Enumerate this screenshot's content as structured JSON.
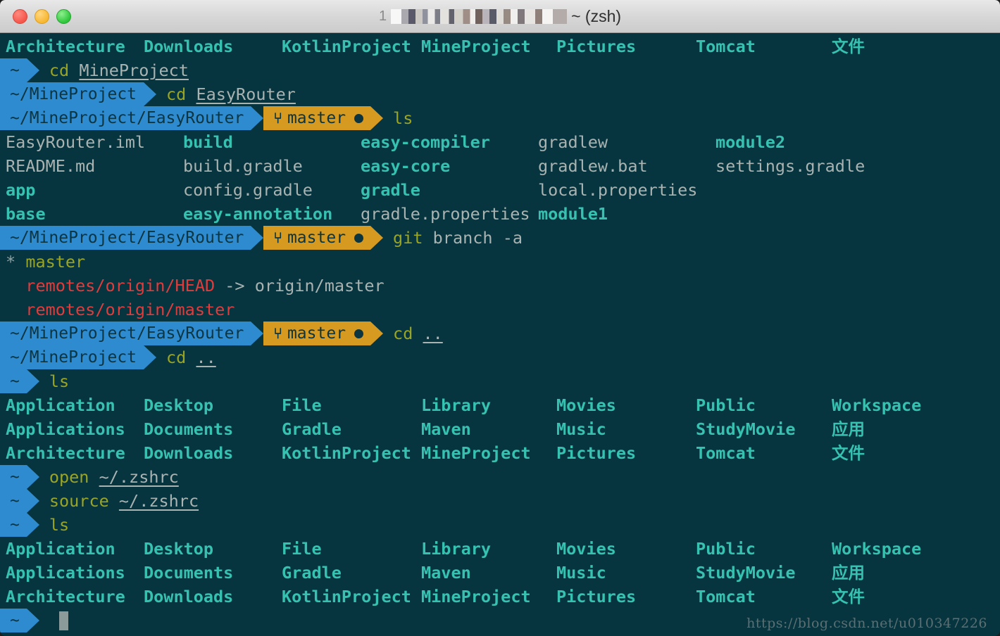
{
  "window": {
    "title_prefix": "1",
    "title_suffix": "~ (zsh)",
    "traffic_lights": [
      "close-button",
      "minimize-button",
      "zoom-button"
    ]
  },
  "terminal": {
    "watermark": "https://blog.csdn.net/u010347226",
    "scrollback_top_row": {
      "cells": [
        "Architecture",
        "Downloads",
        "KotlinProject",
        "MineProject",
        "Pictures",
        "Tomcat",
        "文件"
      ]
    },
    "prompts": {
      "home": "~",
      "mineproject": "~/MineProject",
      "easyrouter": "~/MineProject/EasyRouter",
      "branch": "master",
      "branch_glyph": "⑂"
    },
    "commands": {
      "cd_mineproject": {
        "cmd": "cd",
        "arg": "MineProject"
      },
      "cd_easyrouter": {
        "cmd": "cd",
        "arg": "EasyRouter"
      },
      "ls_1": {
        "cmd": "ls",
        "arg": ""
      },
      "git_branch_a": {
        "cmd": "git",
        "arg": "branch -a"
      },
      "cd_up_1": {
        "cmd": "cd",
        "arg": ".."
      },
      "cd_up_2": {
        "cmd": "cd",
        "arg": ".."
      },
      "ls_2": {
        "cmd": "ls",
        "arg": ""
      },
      "open_zshrc": {
        "cmd": "open",
        "arg": "~/.zshrc"
      },
      "source_zshrc": {
        "cmd": "source",
        "arg": "~/.zshrc"
      },
      "ls_3": {
        "cmd": "ls",
        "arg": ""
      }
    },
    "project_listing": {
      "rows": [
        [
          {
            "text": "EasyRouter.iml",
            "kind": "file"
          },
          {
            "text": "build",
            "kind": "dir"
          },
          {
            "text": "easy-compiler",
            "kind": "dir"
          },
          {
            "text": "gradlew",
            "kind": "file"
          },
          {
            "text": "module2",
            "kind": "dir"
          }
        ],
        [
          {
            "text": "README.md",
            "kind": "file"
          },
          {
            "text": "build.gradle",
            "kind": "file"
          },
          {
            "text": "easy-core",
            "kind": "dir"
          },
          {
            "text": "gradlew.bat",
            "kind": "file"
          },
          {
            "text": "settings.gradle",
            "kind": "file"
          }
        ],
        [
          {
            "text": "app",
            "kind": "dir"
          },
          {
            "text": "config.gradle",
            "kind": "file"
          },
          {
            "text": "gradle",
            "kind": "dir"
          },
          {
            "text": "local.properties",
            "kind": "file"
          },
          {
            "text": "",
            "kind": "file"
          }
        ],
        [
          {
            "text": "base",
            "kind": "dir"
          },
          {
            "text": "easy-annotation",
            "kind": "dir"
          },
          {
            "text": "gradle.properties",
            "kind": "file"
          },
          {
            "text": "module1",
            "kind": "dir"
          },
          {
            "text": "",
            "kind": "file"
          }
        ]
      ]
    },
    "git_branch_output": {
      "current_marker": "*",
      "current_branch": "master",
      "remote_head": "remotes/origin/HEAD",
      "remote_head_arrow": "->",
      "remote_head_target": "origin/master",
      "remote_master": "remotes/origin/master"
    },
    "home_listing": {
      "rows": [
        [
          "Application",
          "Desktop",
          "File",
          "Library",
          "Movies",
          "Public",
          "Workspace"
        ],
        [
          "Applications",
          "Documents",
          "Gradle",
          "Maven",
          "Music",
          "StudyMovie",
          "应用"
        ],
        [
          "Architecture",
          "Downloads",
          "KotlinProject",
          "MineProject",
          "Pictures",
          "Tomcat",
          "文件"
        ]
      ]
    },
    "colors": {
      "background": "#063540",
      "directory": "#37c1b0",
      "file": "#a9b3b1",
      "command": "#9aa425",
      "remote_branch": "#e03c3c",
      "prompt_path": "#2e8bd0",
      "prompt_git": "#d79a21"
    }
  }
}
